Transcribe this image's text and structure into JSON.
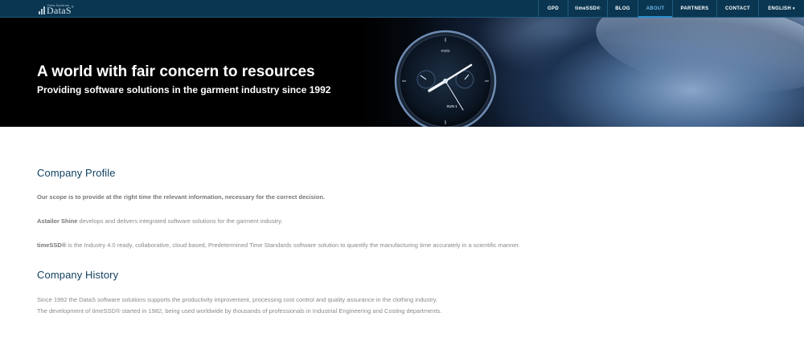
{
  "nav": {
    "logo_small": "Data Systems",
    "logo_text": "DataS",
    "items": [
      {
        "label": "GPD",
        "active": false
      },
      {
        "label": "timeSSD®",
        "active": false
      },
      {
        "label": "BLOG",
        "active": false
      },
      {
        "label": "ABOUT",
        "active": true
      },
      {
        "label": "PARTNERS",
        "active": false
      },
      {
        "label": "CONTACT",
        "active": false
      },
      {
        "label": "ENGLISH",
        "active": false
      }
    ],
    "language_caret": "▾"
  },
  "hero": {
    "title": "A world with fair concern to resources",
    "subtitle": "Providing software solutions in the garment industry since 1992",
    "watch_brand": "moto",
    "watch_date": "SUN 1"
  },
  "profile": {
    "title": "Company Profile",
    "scope": "Our scope is to provide at the right time the relevant information, necessary for the correct decision.",
    "shine_bold": "Astailor Shine",
    "shine_text": " develops and delivers integrated software solutions for the garment industry.",
    "timessd_bold": "timeSSD®",
    "timessd_text": " is the Industry 4.0 ready, collaborative, cloud based, Predetermined Time Standards software solution to quantify the manufacturing time accurately in a scientific manner."
  },
  "history": {
    "title": "Company History",
    "line1": "Since 1992 the DataS software solutions supports the productivity improvement, processing cost control and quality assurance in the clothing industry.",
    "line2": "The development of timeSSD® started in 1982, being used worldwide by thousands of professionals in Industrial Engineering and Costing departments."
  },
  "colors": {
    "nav_bg": "#0a3651",
    "heading": "#0e3f5f",
    "body_text": "#8a8a8a",
    "active_nav": "#6ab6e6"
  }
}
